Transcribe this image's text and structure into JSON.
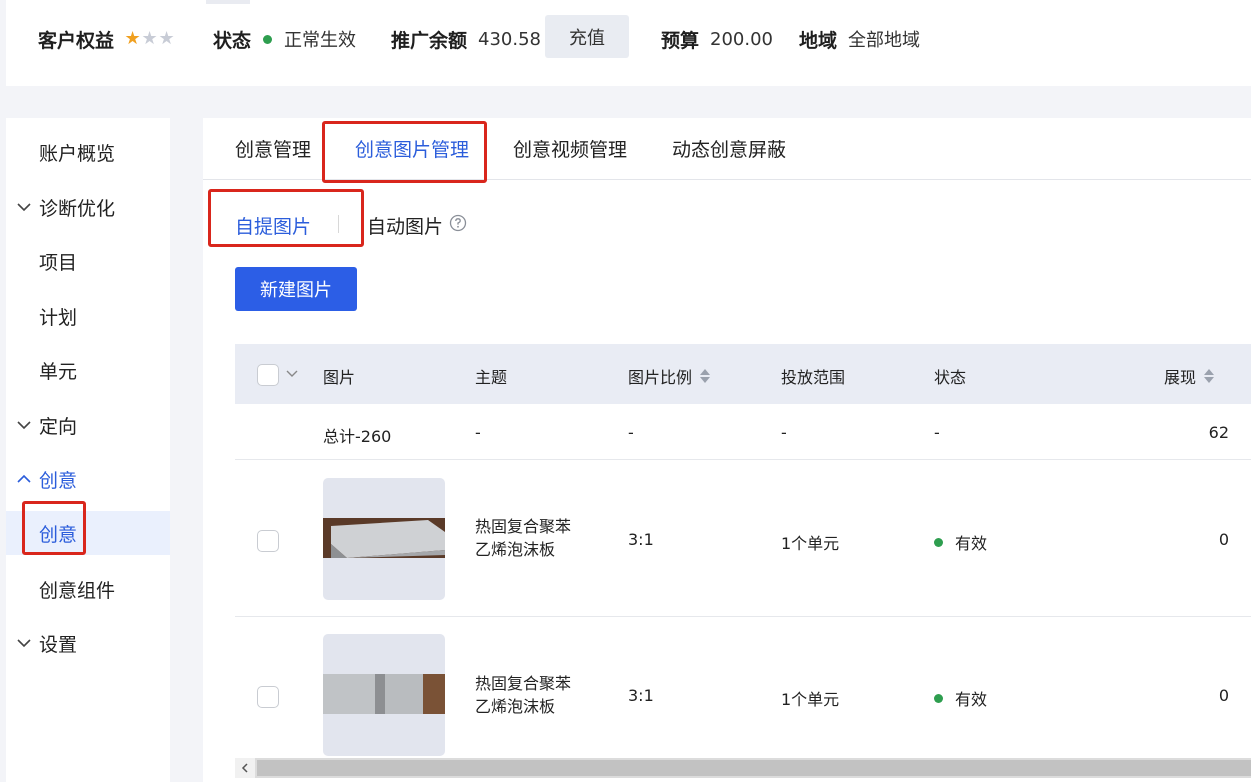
{
  "account": {
    "rights_label": "客户权益",
    "stars_filled": 1,
    "stars_total": 3,
    "status_label": "状态",
    "status_value": "正常生效",
    "status_color": "#2e9e4f",
    "balance_label": "推广余额",
    "balance_value": "430.58",
    "recharge_label": "充值",
    "budget_label": "预算",
    "budget_value": "200.00",
    "region_label": "地域",
    "region_value": "全部地域"
  },
  "sidebar": {
    "items": [
      {
        "label": "账户概览",
        "icon": null
      },
      {
        "label": "诊断优化",
        "icon": "chevron-down-icon"
      },
      {
        "label": "项目",
        "icon": null
      },
      {
        "label": "计划",
        "icon": null
      },
      {
        "label": "单元",
        "icon": null
      },
      {
        "label": "定向",
        "icon": "chevron-down-icon"
      },
      {
        "label": "创意",
        "icon": "chevron-up-icon"
      },
      {
        "label": "创意",
        "icon": null,
        "selected": true
      },
      {
        "label": "创意组件",
        "icon": null
      },
      {
        "label": "设置",
        "icon": "chevron-down-icon"
      }
    ]
  },
  "tabs": [
    {
      "label": "创意管理"
    },
    {
      "label": "创意图片管理",
      "active": true
    },
    {
      "label": "创意视频管理"
    },
    {
      "label": "动态创意屏蔽"
    }
  ],
  "subtabs": [
    {
      "label": "自提图片",
      "active": true
    },
    {
      "label": "自动图片",
      "icon": "help-circle-icon"
    }
  ],
  "new_button": "新建图片",
  "table": {
    "headers": [
      "图片",
      "主题",
      "图片比例",
      "投放范围",
      "状态",
      "展现"
    ],
    "total_row": {
      "label": "总计-260",
      "theme": "-",
      "ratio": "-",
      "scope": "-",
      "status": "-",
      "impressions": "62"
    },
    "rows": [
      {
        "theme_line1": "热固复合聚苯",
        "theme_line2": "乙烯泡沫板",
        "ratio": "3:1",
        "scope": "1个单元",
        "status": "有效",
        "impressions": "0"
      },
      {
        "theme_line1": "热固复合聚苯",
        "theme_line2": "乙烯泡沫板",
        "ratio": "3:1",
        "scope": "1个单元",
        "status": "有效",
        "impressions": "0"
      }
    ]
  },
  "colors": {
    "accent": "#2b5ddb",
    "primary_button": "#2c5ee6",
    "highlight": "#d9261c",
    "star_filled": "#f0a020",
    "star_empty": "#c8ccd6",
    "valid_dot": "#2e9e4f"
  }
}
